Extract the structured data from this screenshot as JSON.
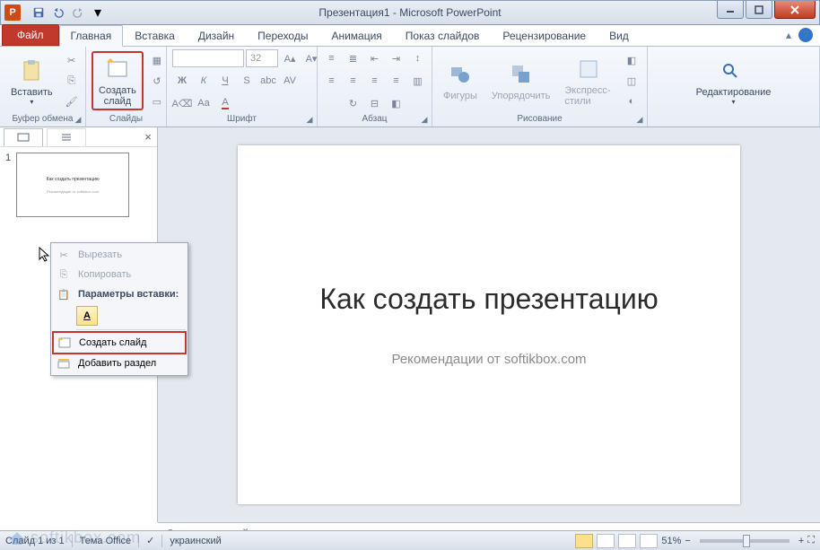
{
  "titlebar": {
    "title": "Презентация1 - Microsoft PowerPoint",
    "app_letter": "P"
  },
  "tabs": {
    "file": "Файл",
    "items": [
      "Главная",
      "Вставка",
      "Дизайн",
      "Переходы",
      "Анимация",
      "Показ слайдов",
      "Рецензирование",
      "Вид"
    ],
    "active_index": 0
  },
  "ribbon": {
    "clipboard": {
      "label": "Буфер обмена",
      "paste": "Вставить"
    },
    "slides": {
      "label": "Слайды",
      "new_slide": "Создать\nслайд"
    },
    "font": {
      "label": "Шрифт",
      "size": "32"
    },
    "paragraph": {
      "label": "Абзац"
    },
    "drawing": {
      "label": "Рисование",
      "shapes": "Фигуры",
      "arrange": "Упорядочить",
      "quick_styles": "Экспресс-стили"
    },
    "editing": {
      "label": "Редактирование"
    }
  },
  "panel": {
    "slide_num": "1"
  },
  "slide": {
    "title": "Как создать презентацию",
    "subtitle": "Рекомендации от softikbox.com"
  },
  "context_menu": {
    "cut": "Вырезать",
    "copy": "Копировать",
    "paste_header": "Параметры вставки:",
    "new_slide": "Создать слайд",
    "add_section": "Добавить раздел"
  },
  "notes": {
    "placeholder": "Заметки к слайду"
  },
  "status": {
    "slide_info": "Слайд 1 из 1",
    "theme": "Тема Office",
    "lang": "украинский",
    "zoom": "51%"
  },
  "watermark": "softikbox.com"
}
